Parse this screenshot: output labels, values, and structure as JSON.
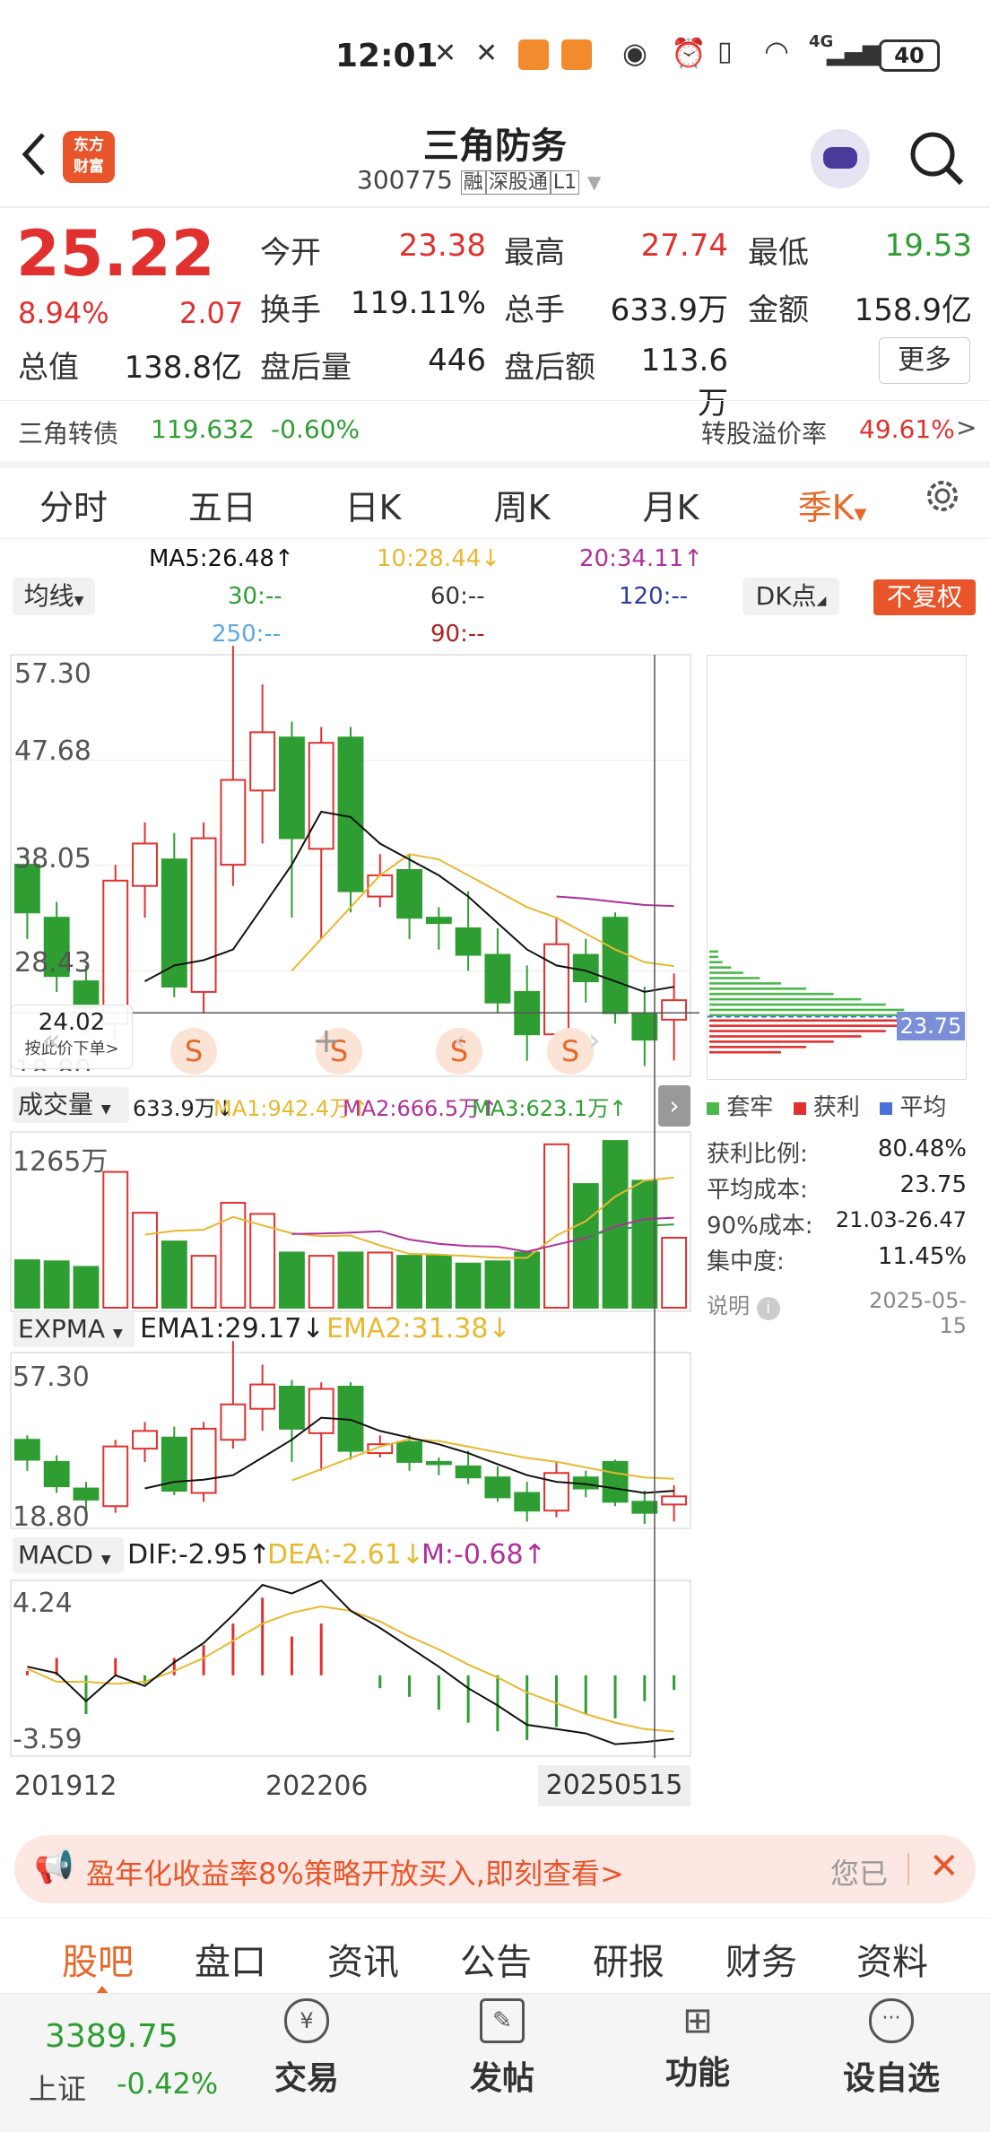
{
  "status_bar": {
    "time": "12:01",
    "network": "4G",
    "battery": "40"
  },
  "header": {
    "title": "三角防务",
    "code": "300775",
    "badges": [
      "融",
      "深股通",
      "L1"
    ],
    "logo_text": [
      "东方",
      "财富"
    ]
  },
  "quote": {
    "price": "25.22",
    "change_pct": "8.94%",
    "change": "2.07",
    "fields": [
      {
        "label": "今开",
        "value": "23.38"
      },
      {
        "label": "最高",
        "value": "27.74"
      },
      {
        "label": "最低",
        "value": "19.53"
      },
      {
        "label": "换手",
        "value": "119.11%"
      },
      {
        "label": "总手",
        "value": "633.9万"
      },
      {
        "label": "金额",
        "value": "158.9亿"
      },
      {
        "label": "总值",
        "value": "138.8亿"
      },
      {
        "label": "盘后量",
        "value": "446"
      },
      {
        "label": "盘后额",
        "value": "113.6万"
      }
    ],
    "more_button": "更多"
  },
  "bond": {
    "name": "三角转债",
    "price": "119.632",
    "change": "-0.60%",
    "premium_label": "转股溢价率",
    "premium_value": "49.61%"
  },
  "chart_tabs": [
    "分时",
    "五日",
    "日K",
    "周K",
    "月K",
    "季K"
  ],
  "active_tab": "季K",
  "ma_row": {
    "selector": "均线",
    "ma5": "MA5:26.48↑",
    "ma10": "10:28.44↓",
    "ma20": "20:34.11↑",
    "ma30": "30:--",
    "ma60": "60:--",
    "ma120": "120:--",
    "ma250": "250:--",
    "ma90": "90:--",
    "dk_button": "DK点",
    "fq_button": "不复权"
  },
  "main_chart": {
    "y_labels": [
      "57.30",
      "47.68",
      "38.05",
      "28.43",
      "18.80"
    ],
    "crosshair_value": "24.02",
    "crosshair_hint": "按此价下单",
    "signal_marks": [
      "S",
      "S",
      "S",
      "S"
    ]
  },
  "volume": {
    "selector": "成交量",
    "current": "633.9万↓",
    "ma1": "MA1:942.4万↑",
    "ma2": "MA2:666.5万↑",
    "ma3": "MA3:623.1万↑",
    "y_max": "1265万"
  },
  "expma": {
    "selector": "EXPMA",
    "ema1": "EMA1:29.17↓",
    "ema2": "EMA2:31.38↓",
    "y_labels": [
      "57.30",
      "18.80"
    ]
  },
  "macd": {
    "selector": "MACD",
    "dif": "DIF:-2.95↑",
    "dea": "DEA:-2.61↓",
    "m": "M:-0.68↑",
    "y_labels": [
      "4.24",
      "-3.59"
    ]
  },
  "x_axis": [
    "201912",
    "202206",
    "20250515"
  ],
  "chip": {
    "price_label": "23.75",
    "legend": [
      "套牢",
      "获利",
      "平均"
    ],
    "rows": [
      {
        "label": "获利比例:",
        "value": "80.48%"
      },
      {
        "label": "平均成本:",
        "value": "23.75"
      },
      {
        "label": "90%成本:",
        "value": "21.03-26.47"
      },
      {
        "label": "集中度:",
        "value": "11.45%"
      }
    ],
    "note": "说明",
    "date": "2025-05-15"
  },
  "banner": {
    "text": "盈年化收益率8%策略开放买入,即刻查看>",
    "tail": "您已"
  },
  "bottom_tabs": [
    "股吧",
    "盘口",
    "资讯",
    "公告",
    "研报",
    "财务",
    "资料"
  ],
  "active_bottom_tab": "股吧",
  "index": {
    "value": "3389.75",
    "name": "上证",
    "change": "-0.42%"
  },
  "nav": [
    "交易",
    "发帖",
    "功能",
    "设自选"
  ],
  "colors": {
    "up": "#e0312f",
    "down": "#2e9e32",
    "accent": "#e8682a",
    "ma5": "#111111",
    "ma10": "#e8b830",
    "ma20": "#b0309a"
  },
  "chart_data": [
    {
      "type": "candlestick",
      "title": "",
      "period": "quarterly",
      "ylim": [
        18.8,
        57.3
      ],
      "x_ticks": [
        "201912",
        "202206",
        "20250515"
      ],
      "candles": [
        {
          "o": 38.0,
          "c": 33.5,
          "h": 39.0,
          "l": 31.0
        },
        {
          "o": 33.0,
          "c": 27.5,
          "h": 34.5,
          "l": 26.0
        },
        {
          "o": 27.0,
          "c": 24.5,
          "h": 28.5,
          "l": 22.0
        },
        {
          "o": 23.0,
          "c": 36.5,
          "h": 38.0,
          "l": 21.5
        },
        {
          "o": 36.0,
          "c": 40.0,
          "h": 42.0,
          "l": 33.0
        },
        {
          "o": 38.5,
          "c": 26.5,
          "h": 41.0,
          "l": 25.5
        },
        {
          "o": 26.0,
          "c": 40.5,
          "h": 42.0,
          "l": 24.0
        },
        {
          "o": 38.0,
          "c": 46.0,
          "h": 61.0,
          "l": 36.0
        },
        {
          "o": 45.0,
          "c": 50.5,
          "h": 55.0,
          "l": 40.0
        },
        {
          "o": 50.0,
          "c": 40.5,
          "h": 51.5,
          "l": 33.0
        },
        {
          "o": 39.5,
          "c": 49.5,
          "h": 51.0,
          "l": 31.0
        },
        {
          "o": 50.0,
          "c": 35.5,
          "h": 51.0,
          "l": 33.5
        },
        {
          "o": 35.0,
          "c": 37.0,
          "h": 39.0,
          "l": 34.0
        },
        {
          "o": 37.5,
          "c": 33.0,
          "h": 39.0,
          "l": 31.0
        },
        {
          "o": 33.0,
          "c": 32.5,
          "h": 34.0,
          "l": 30.0
        },
        {
          "o": 32.0,
          "c": 29.5,
          "h": 35.5,
          "l": 28.0
        },
        {
          "o": 29.5,
          "c": 25.0,
          "h": 32.0,
          "l": 24.0
        },
        {
          "o": 26.0,
          "c": 22.0,
          "h": 28.5,
          "l": 19.5
        },
        {
          "o": 22.0,
          "c": 30.5,
          "h": 33.0,
          "l": 20.5
        },
        {
          "o": 29.5,
          "c": 27.0,
          "h": 31.0,
          "l": 25.0
        },
        {
          "o": 33.0,
          "c": 24.0,
          "h": 33.5,
          "l": 23.0
        },
        {
          "o": 24.0,
          "c": 21.5,
          "h": 26.5,
          "l": 19.0
        },
        {
          "o": 23.38,
          "c": 25.22,
          "h": 27.74,
          "l": 19.53
        }
      ],
      "ma5": [
        null,
        null,
        null,
        null,
        27.0,
        28.5,
        29.0,
        30.0,
        34.0,
        38.0,
        43.0,
        42.5,
        40.0,
        38.5,
        37.0,
        35.0,
        32.5,
        30.0,
        28.5,
        28.0,
        27.0,
        26.0,
        26.48
      ],
      "ma10": [
        null,
        null,
        null,
        null,
        null,
        null,
        null,
        null,
        null,
        28.0,
        31.0,
        34.0,
        37.0,
        39.0,
        38.5,
        37.0,
        35.5,
        34.0,
        33.0,
        31.5,
        30.0,
        28.8,
        28.44
      ],
      "ma20": [
        null,
        null,
        null,
        null,
        null,
        null,
        null,
        null,
        null,
        null,
        null,
        null,
        null,
        null,
        null,
        null,
        null,
        null,
        35.0,
        34.8,
        34.5,
        34.2,
        34.11
      ]
    },
    {
      "type": "bar",
      "title": "成交量",
      "ylim": [
        0,
        1265
      ],
      "unit": "万",
      "values": [
        430,
        420,
        370,
        1230,
        860,
        600,
        470,
        950,
        850,
        500,
        470,
        500,
        500,
        470,
        470,
        400,
        420,
        500,
        1480,
        1120,
        1510,
        1150,
        634
      ]
    },
    {
      "type": "bar",
      "title": "MACD",
      "ylim": [
        -3.59,
        4.24
      ],
      "dif": [
        0.4,
        0.1,
        -1.2,
        0.0,
        -0.5,
        0.6,
        1.5,
        2.8,
        4.2,
        3.8,
        4.4,
        3.0,
        2.2,
        1.3,
        0.4,
        -0.6,
        -1.4,
        -2.3,
        -2.5,
        -2.7,
        -3.2,
        -3.1,
        -2.95
      ],
      "dea": [
        0.3,
        -0.3,
        -0.3,
        -0.4,
        -0.3,
        0.2,
        0.8,
        1.6,
        2.4,
        2.9,
        3.2,
        3.0,
        2.5,
        1.8,
        1.2,
        0.5,
        -0.1,
        -0.8,
        -1.3,
        -1.8,
        -2.2,
        -2.5,
        -2.61
      ]
    }
  ]
}
